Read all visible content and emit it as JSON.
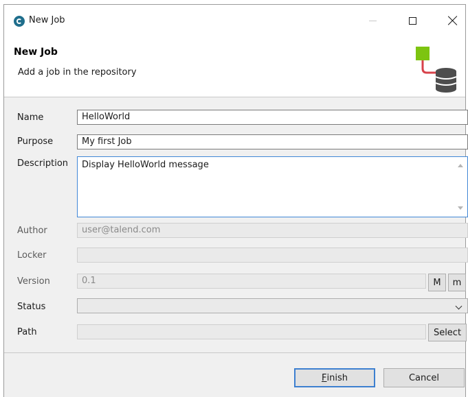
{
  "window": {
    "title": "New Job",
    "icon": "talend-logo-icon"
  },
  "header": {
    "title": "New Job",
    "description": "Add a job in the repository",
    "icon": "job-repository-icon",
    "colors": {
      "square": "#7dc410",
      "connector": "#d7424a",
      "database": "#4d4d4d"
    }
  },
  "form": {
    "name": {
      "label": "Name",
      "value": "HelloWorld"
    },
    "purpose": {
      "label": "Purpose",
      "value": "My first Job"
    },
    "description": {
      "label": "Description",
      "value": "Display HelloWorld message"
    },
    "author": {
      "label": "Author",
      "value": "user@talend.com"
    },
    "locker": {
      "label": "Locker",
      "value": ""
    },
    "version": {
      "label": "Version",
      "value": "0.1",
      "major_label": "M",
      "minor_label": "m"
    },
    "status": {
      "label": "Status",
      "value": ""
    },
    "path": {
      "label": "Path",
      "value": "",
      "select_label": "Select"
    }
  },
  "buttons": {
    "finish_mnemonic": "F",
    "finish_rest": "inish",
    "cancel": "Cancel"
  },
  "colors": {
    "focus": "#3c7fd0",
    "dialog_bg": "#f0f0f0"
  }
}
